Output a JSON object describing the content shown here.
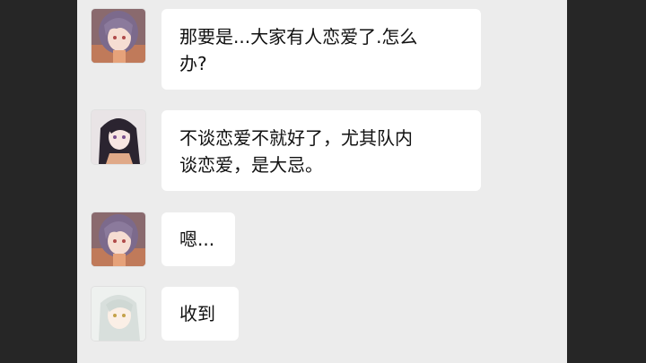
{
  "messages": [
    {
      "text": "那要是...大家有人恋爱了.怎么\n办?",
      "avatar": "purple-hair-girl-avatar"
    },
    {
      "text": "不谈恋爱不就好了，尤其队内\n谈恋爱，是大忌。",
      "avatar": "dark-hair-girl-avatar"
    },
    {
      "text": "嗯...",
      "avatar": "purple-hair-girl-avatar"
    },
    {
      "text": "收到",
      "avatar": "silver-hair-girl-avatar"
    }
  ],
  "colors": {
    "panel_bg": "#ececec",
    "bubble_bg": "#ffffff",
    "outer_bg": "#262626"
  }
}
